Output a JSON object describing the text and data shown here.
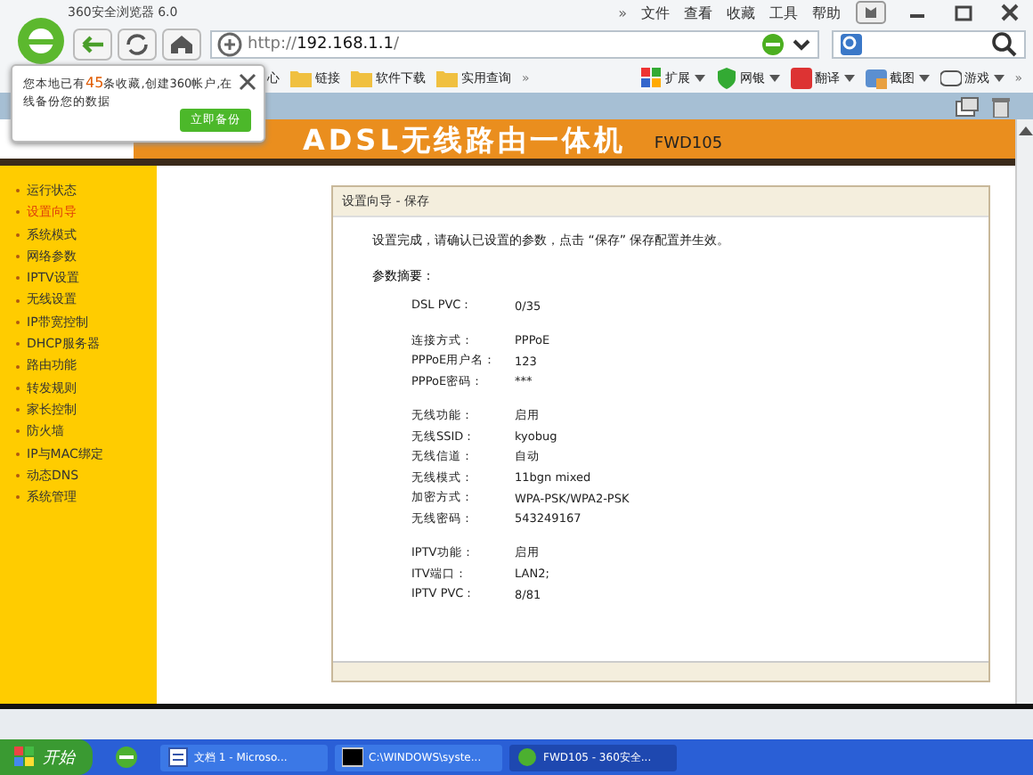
{
  "window": {
    "title": "360安全浏览器 6.0"
  },
  "menu": [
    "文件",
    "查看",
    "收藏",
    "工具",
    "帮助"
  ],
  "address": {
    "prefix": "http://",
    "host": "192.168.1.1",
    "suffix": "/"
  },
  "bookmarks": [
    "心",
    "链接",
    "软件下载",
    "实用查询"
  ],
  "bookmarks_more": "»",
  "toolbar_right": [
    "扩展",
    "网银",
    "翻译",
    "截图",
    "游戏"
  ],
  "toolbar_more": "»",
  "popup": {
    "text_before": "您本地已有",
    "count": "45",
    "text_after": "条收藏,创建360帐户,在线备份您的数据",
    "button": "立即备份"
  },
  "header": {
    "title": "ADSL无线路由一体机",
    "model": "FWD105"
  },
  "sidebar": {
    "items": [
      {
        "label": "运行状态",
        "selected": false
      },
      {
        "label": "设置向导",
        "selected": true
      },
      {
        "label": "系统模式",
        "selected": false
      },
      {
        "label": "网络参数",
        "selected": false
      },
      {
        "label": "IPTV设置",
        "selected": false
      },
      {
        "label": "无线设置",
        "selected": false
      },
      {
        "label": "IP带宽控制",
        "selected": false
      },
      {
        "label": "DHCP服务器",
        "selected": false
      },
      {
        "label": "路由功能",
        "selected": false
      },
      {
        "label": "转发规则",
        "selected": false
      },
      {
        "label": "家长控制",
        "selected": false
      },
      {
        "label": "防火墙",
        "selected": false
      },
      {
        "label": "IP与MAC绑定",
        "selected": false
      },
      {
        "label": "动态DNS",
        "selected": false
      },
      {
        "label": "系统管理",
        "selected": false
      }
    ]
  },
  "panel": {
    "title": "设置向导 - 保存",
    "intro": "设置完成，请确认已设置的参数，点击 “保存” 保存配置并生效。",
    "summary_label": "参数摘要：",
    "groups": [
      [
        {
          "label": "DSL PVC：",
          "value": "0/35"
        }
      ],
      [
        {
          "label": "连接方式：",
          "value": "PPPoE"
        },
        {
          "label": "PPPoE用户名：",
          "value": "123"
        },
        {
          "label": "PPPoE密码：",
          "value": "***"
        }
      ],
      [
        {
          "label": "无线功能：",
          "value": "启用"
        },
        {
          "label": "无线SSID：",
          "value": "kyobug"
        },
        {
          "label": "无线信道：",
          "value": "自动"
        },
        {
          "label": "无线模式：",
          "value": "11bgn mixed"
        },
        {
          "label": "加密方式：",
          "value": "WPA-PSK/WPA2-PSK"
        },
        {
          "label": "无线密码：",
          "value": "543249167"
        }
      ],
      [
        {
          "label": "IPTV功能：",
          "value": "启用"
        },
        {
          "label": "ITV端口：",
          "value": "LAN2;"
        },
        {
          "label": "IPTV PVC：",
          "value": "8/81"
        }
      ]
    ]
  },
  "taskbar": {
    "start": "开始",
    "tasks": [
      {
        "label": "文档 1 - Microso...",
        "kind": "word",
        "selected": false
      },
      {
        "label": "C:\\WINDOWS\\syste...",
        "kind": "cmd",
        "selected": false
      },
      {
        "label": "FWD105 - 360安全...",
        "kind": "browser",
        "selected": true
      }
    ]
  }
}
